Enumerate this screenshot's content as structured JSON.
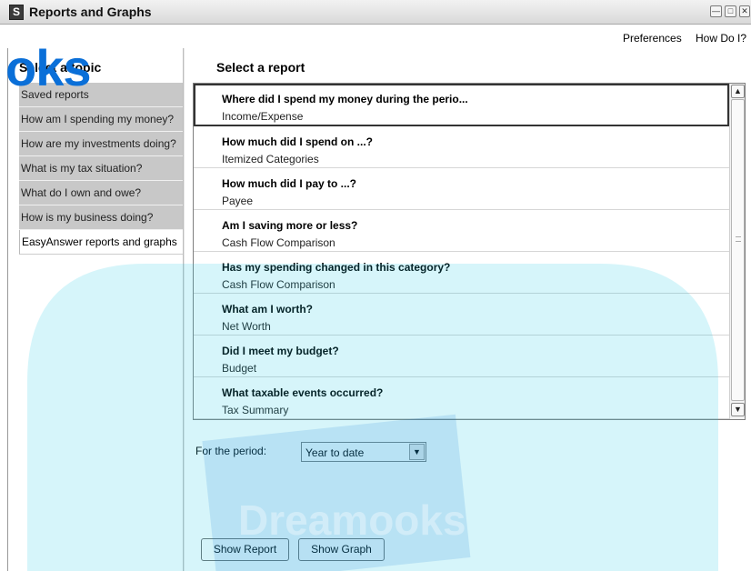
{
  "window": {
    "title": "Reports and Graphs",
    "icon_letter": "S"
  },
  "menu": {
    "preferences": "Preferences",
    "how_do_i": "How Do I?"
  },
  "left": {
    "heading": "Select a topic",
    "topics": [
      "Saved reports",
      "How am I spending my money?",
      "How are my investments doing?",
      "What is my tax situation?",
      "What do I own and owe?",
      "How is my business doing?",
      "EasyAnswer reports and graphs"
    ],
    "selected_index": 6
  },
  "right": {
    "heading": "Select a report",
    "reports": [
      {
        "question": "Where did I spend my money during the perio...",
        "answer": "Income/Expense"
      },
      {
        "question": "How much did I spend on ...?",
        "answer": "Itemized Categories"
      },
      {
        "question": "How much did I pay to ...?",
        "answer": "Payee"
      },
      {
        "question": "Am I saving more or less?",
        "answer": "Cash Flow Comparison"
      },
      {
        "question": "Has my spending changed in this category?",
        "answer": "Cash Flow Comparison"
      },
      {
        "question": "What am I worth?",
        "answer": "Net Worth"
      },
      {
        "question": "Did I meet my budget?",
        "answer": "Budget"
      },
      {
        "question": "What taxable events occurred?",
        "answer": "Tax Summary"
      }
    ]
  },
  "period": {
    "label": "For the period:",
    "value": "Year to date"
  },
  "buttons": {
    "show_report": "Show Report",
    "show_graph": "Show Graph"
  },
  "watermark": {
    "top_text": "oks",
    "bottom_text": "Dreamooks"
  },
  "colors": {
    "watermark_blue": "#0a6fd8",
    "watermark_cyan": "#1ec8e6",
    "topic_bg": "#c8c8c8"
  }
}
